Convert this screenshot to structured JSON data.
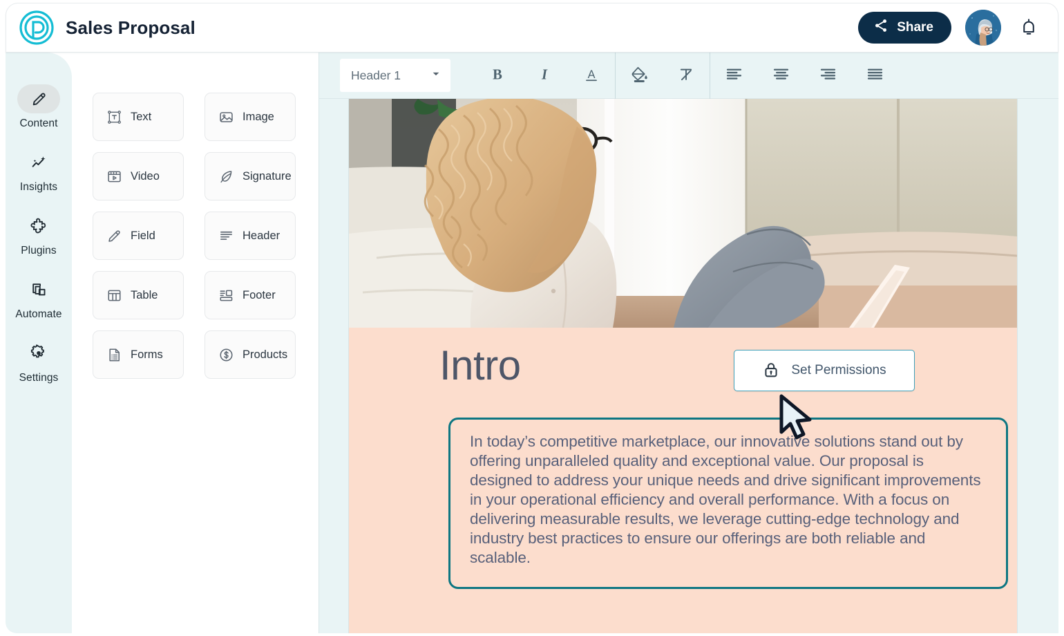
{
  "header": {
    "logo_icon": "proposify-p-logo-icon",
    "title": "Sales Proposal",
    "share_label": "Share",
    "share_icon": "share-icon",
    "avatar_icon": "user-avatar",
    "bell_icon": "notification-bell-icon",
    "brand_color": "#15BDD4",
    "share_bg": "#0C2D48"
  },
  "sidebar": {
    "items": [
      {
        "label": "Content",
        "icon": "pencil-icon",
        "active": true
      },
      {
        "label": "Insights",
        "icon": "sparkle-chart-icon",
        "active": false
      },
      {
        "label": "Plugins",
        "icon": "puzzle-piece-icon",
        "active": false
      },
      {
        "label": "Automate",
        "icon": "copy-layers-icon",
        "active": false
      },
      {
        "label": "Settings",
        "icon": "gear-icon",
        "active": false
      }
    ]
  },
  "palette": {
    "items": [
      {
        "label": "Text",
        "icon": "text-box-icon"
      },
      {
        "label": "Image",
        "icon": "image-icon"
      },
      {
        "label": "Video",
        "icon": "video-player-icon"
      },
      {
        "label": "Signature",
        "icon": "feather-quill-icon"
      },
      {
        "label": "Field",
        "icon": "pencil-icon"
      },
      {
        "label": "Header",
        "icon": "header-lines-icon"
      },
      {
        "label": "Table",
        "icon": "table-grid-icon"
      },
      {
        "label": "Footer",
        "icon": "footer-lines-icon"
      },
      {
        "label": "Forms",
        "icon": "form-document-icon"
      },
      {
        "label": "Products",
        "icon": "dollar-circle-icon"
      }
    ]
  },
  "toolbar": {
    "style_value": "Header 1",
    "style_chevron_icon": "chevron-down-icon",
    "bold_label": "B",
    "bold_icon": "bold-icon",
    "italic_label": "I",
    "italic_icon": "italic-icon",
    "underline_label": "A",
    "text_color_icon": "text-color-underline-icon",
    "fill_icon": "paint-bucket-icon",
    "clear_format_icon": "clear-formatting-icon",
    "align_left_icon": "align-left-icon",
    "align_center_icon": "align-center-icon",
    "align_right_icon": "align-right-icon",
    "align_justify_icon": "align-justify-icon"
  },
  "canvas": {
    "hero_image_alt": "woman-with-curly-hair-sitting-on-floor-using-laptop",
    "section_title": "Intro",
    "permissions_button": {
      "label": "Set Permissions",
      "icon": "lock-icon",
      "border_color": "#3F9FB8"
    },
    "body_text": "In today’s competitive marketplace, our innovative solutions stand out by offering unparalleled quality and exceptional value. Our proposal is designed to address your unique needs and drive significant improvements in your operational efficiency and overall performance. With a focus on delivering measurable results, we leverage cutting-edge technology and industry best practices to ensure our offerings are both reliable and scalable.",
    "selection_border_color": "#0D7682",
    "section_bg_color": "#FCDDCD",
    "cursor_icon": "mouse-pointer-arrow"
  }
}
